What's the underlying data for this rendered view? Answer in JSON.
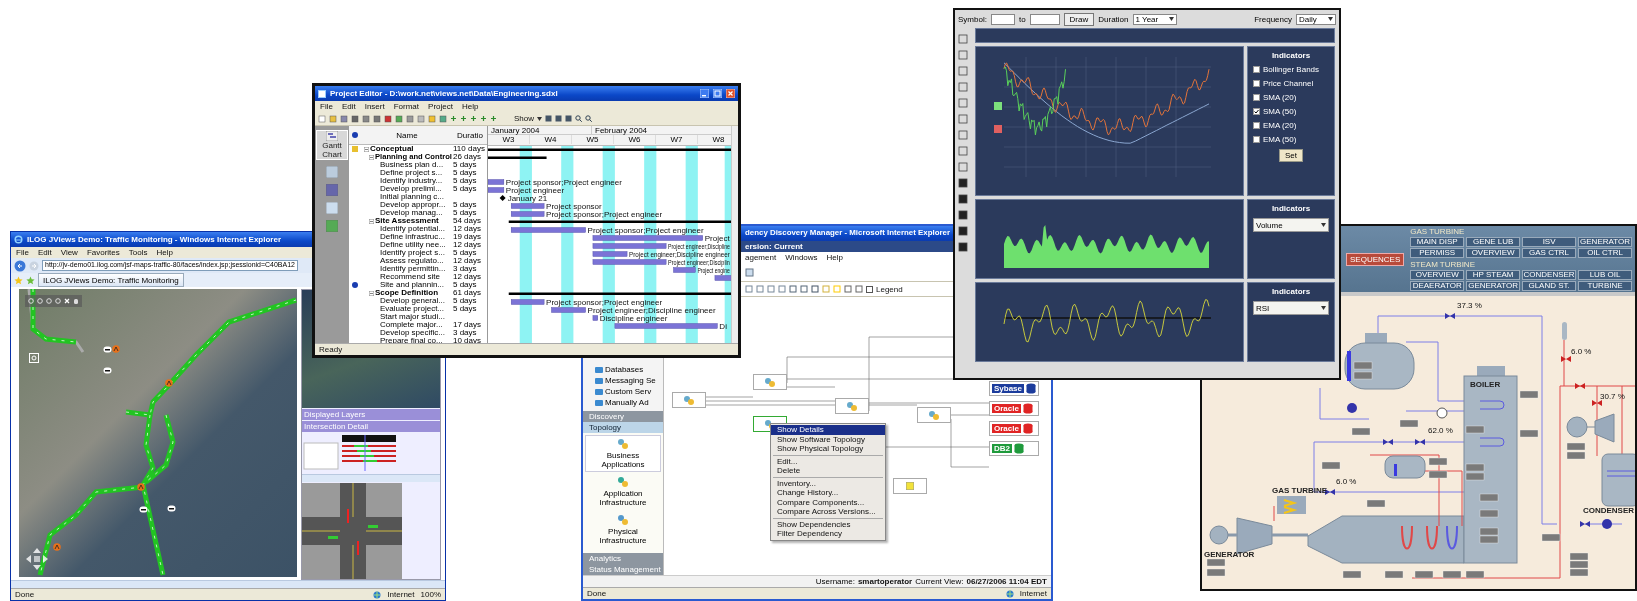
{
  "traffic_window": {
    "title": "ILOG JViews Demo: Traffic Monitoring - Windows Internet Explorer",
    "menu": [
      "File",
      "Edit",
      "View",
      "Favorites",
      "Tools",
      "Help"
    ],
    "address": "http://jv-demo01.ilog.com/jsf-maps-traffic-80/faces/index.jsp;jsessionid=C40BA12",
    "tab": "ILOG JViews Demo: Traffic Monitoring",
    "panels": [
      "Displayed Layers",
      "Intersection Detail"
    ],
    "status": "Done",
    "zone": "Internet",
    "zoom": "100%"
  },
  "dependency_window": {
    "title": "dency Discovery Manager - Microsoft Internet Explorer",
    "version": "ersion: Current",
    "menu": [
      "agement",
      "Windows",
      "Help"
    ],
    "legend": {
      "label": "Legend",
      "checked": false
    },
    "tree": [
      "Databases",
      "Messaging Se",
      "Custom Serv",
      "Manually Ad"
    ],
    "sections": [
      {
        "label": "Discovery",
        "selected": false
      },
      {
        "label": "Topology",
        "selected": true
      }
    ],
    "views": [
      {
        "label": "Business Applications",
        "selected": true
      },
      {
        "label": "Application Infrastructure",
        "selected": false
      },
      {
        "label": "Physical Infrastructure",
        "selected": false
      }
    ],
    "bottom_sections": [
      "Analytics",
      "Status Management"
    ],
    "databases": [
      {
        "label": "Sybase",
        "color": "#1c3c9c"
      },
      {
        "label": "Oracle",
        "color": "#e02424"
      },
      {
        "label": "Oracle",
        "color": "#e02424"
      },
      {
        "label": "DB2",
        "color": "#1f9a3c"
      }
    ],
    "context_menu": [
      [
        {
          "label": "Show Details",
          "selected": true
        },
        {
          "label": "Show Software Topology",
          "selected": false
        },
        {
          "label": "Show Physical Topology",
          "selected": false
        }
      ],
      [
        {
          "label": "Edit...",
          "selected": false
        },
        {
          "label": "Delete",
          "selected": false
        }
      ],
      [
        {
          "label": "Inventory...",
          "selected": false
        },
        {
          "label": "Change History...",
          "selected": false
        },
        {
          "label": "Compare Components...",
          "selected": false
        },
        {
          "label": "Compare Across Versions...",
          "selected": false
        }
      ],
      [
        {
          "label": "Show Dependencies",
          "selected": false
        },
        {
          "label": "Filter Dependency",
          "selected": false
        }
      ]
    ],
    "user_label": "Username:",
    "user": "smartoperator",
    "view_label": "Current View:",
    "view": "06/27/2006 11:04 EDT",
    "status": "Done",
    "zone": "Internet"
  },
  "project_window": {
    "title": "Project Editor - D:\\work.net\\views.net\\Data\\Engineering.sdxl",
    "menu": [
      "File",
      "Edit",
      "Insert",
      "Format",
      "Project",
      "Help"
    ],
    "show_label": "Show",
    "sidebar": [
      {
        "label": "Gantt Chart",
        "selected": true
      }
    ],
    "columns": [
      "Name",
      "Duratio"
    ],
    "months": [
      "January 2004",
      "February 2004"
    ],
    "weeks": [
      "W3",
      "W4",
      "W5",
      "W6",
      "W7",
      "W8"
    ],
    "tasks": [
      {
        "name": "Conceptual",
        "duration": "110 days",
        "kind": "note",
        "expanded": true,
        "children": [
          {
            "name": "Planning and Control",
            "duration": "26 days",
            "expanded": true,
            "children": [
              {
                "name": "Business plan d...",
                "duration": "5 days"
              },
              {
                "name": "Define project s...",
                "duration": "5 days"
              },
              {
                "name": "Identify industry...",
                "duration": "5 days",
                "resources": "Project sponsor;Project engineer"
              },
              {
                "name": "Develop prelimi...",
                "duration": "5 days",
                "resources": "Project engineer"
              },
              {
                "name": "Initial planning c...",
                "resources": "January 21"
              },
              {
                "name": "Develop appropr...",
                "duration": "5 days",
                "resources": "Project sponsor"
              },
              {
                "name": "Develop manag...",
                "duration": "5 days",
                "resources": "Project sponsor;Project engineer"
              }
            ]
          },
          {
            "name": "Site Assessment",
            "duration": "54 days",
            "expanded": true,
            "children": [
              {
                "name": "Identify potential...",
                "duration": "12 days",
                "resources": "Project sponsor;Project engineer"
              },
              {
                "name": "Define infrastruc...",
                "duration": "19 days",
                "resources": "Project"
              },
              {
                "name": "Define utility nee...",
                "duration": "12 days",
                "resources": "Project engineer;Discipline"
              },
              {
                "name": "Identify project s...",
                "duration": "5 days",
                "resources": "Project engineer;Discipline engineer"
              },
              {
                "name": "Assess regulato...",
                "duration": "12 days",
                "resources": "Project engineer;Disciplin"
              },
              {
                "name": "Identify permittin...",
                "duration": "3 days",
                "resources": "Project engine"
              },
              {
                "name": "Recommend site",
                "duration": "12 days"
              },
              {
                "name": "Site and plannin...",
                "duration": "5 days",
                "kind": "info"
              }
            ]
          },
          {
            "name": "Scope Definition",
            "duration": "61 days",
            "expanded": true,
            "children": [
              {
                "name": "Develop general...",
                "duration": "5 days",
                "resources": "Project sponsor;Project engineer"
              },
              {
                "name": "Evaluate project...",
                "duration": "5 days",
                "resources": "Project engineer;Discipline engineer"
              },
              {
                "name": "Start major studi...",
                "resources": "Discipline engineer"
              },
              {
                "name": "Complete major...",
                "duration": "17 days",
                "resources": "Di"
              },
              {
                "name": "Develop specific...",
                "duration": "3 days"
              },
              {
                "name": "Prepare final co...",
                "duration": "10 days"
              }
            ]
          }
        ]
      }
    ],
    "status": "Ready"
  },
  "stock_window": {
    "symbol_label": "Symbol:",
    "to_label": "to",
    "draw": "Draw",
    "duration_label": "Duration",
    "duration": "1 Year",
    "frequency_label": "Frequency",
    "frequency": "Daily",
    "indicator_panels": [
      {
        "kind": "checks",
        "title": "Indicators",
        "options": [
          {
            "label": "Bollinger Bands",
            "checked": false
          },
          {
            "label": "Price Channel",
            "checked": false
          },
          {
            "label": "SMA (20)",
            "checked": false
          },
          {
            "label": "SMA (50)",
            "checked": true
          },
          {
            "label": "EMA (20)",
            "checked": false
          },
          {
            "label": "EMA (50)",
            "checked": false
          }
        ],
        "button": "Set"
      },
      {
        "kind": "select",
        "title": "Indicators",
        "value": "Volume"
      },
      {
        "kind": "select",
        "title": "Indicators",
        "value": "RSI"
      }
    ]
  },
  "process_window": {
    "sequence_button": "SEQUENCES",
    "groups": [
      {
        "label": "GAS TURBINE",
        "buttons": [
          [
            "MAIN DISP",
            "GENE LUB",
            "ISV",
            "GENERATOR"
          ],
          [
            "PERMISS",
            "OVERVIEW",
            "GAS CTRL",
            "OIL CTRL"
          ]
        ]
      },
      {
        "label": "STEAM TURBINE",
        "buttons": [
          [
            "OVERVIEW",
            "HP STEAM",
            "CONDENSER",
            "LUB OIL"
          ],
          [
            "DEAERATOR",
            "GENERATOR",
            "GLAND ST.",
            "TURBINE"
          ]
        ]
      }
    ],
    "units": [
      "BOILER",
      "GAS TURBINE",
      "GENERATOR",
      "CONDENSER"
    ],
    "valve_readings": [
      "37.3 %",
      "62.0 %",
      "6.0 %",
      "6.0 %",
      "30.7 %"
    ]
  }
}
